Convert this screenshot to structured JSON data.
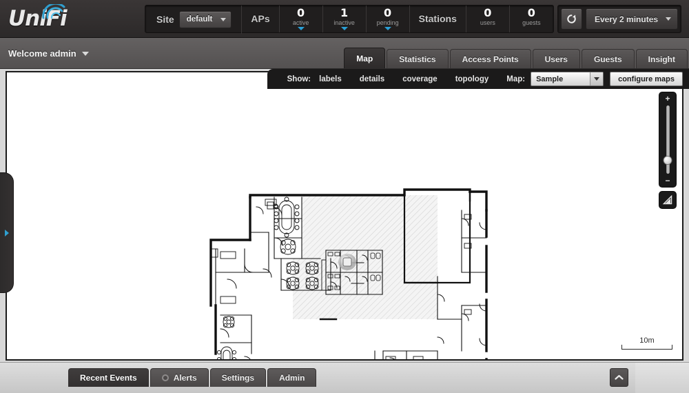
{
  "header": {
    "brand": "UniFi",
    "site_label": "Site",
    "site_value": "default",
    "aps_label": "APs",
    "stations_label": "Stations",
    "stats": [
      {
        "num": "0",
        "sub": "active",
        "caret": true
      },
      {
        "num": "1",
        "sub": "inactive",
        "caret": true
      },
      {
        "num": "0",
        "sub": "pending",
        "caret": true
      },
      {
        "num": "0",
        "sub": "users",
        "caret": false
      },
      {
        "num": "0",
        "sub": "guests",
        "caret": false
      }
    ],
    "refresh_icon": "refresh-icon",
    "refresh_value": "Every 2 minutes"
  },
  "nav": {
    "welcome": "Welcome admin",
    "tabs": [
      {
        "label": "Map",
        "active": true
      },
      {
        "label": "Statistics",
        "active": false
      },
      {
        "label": "Access Points",
        "active": false
      },
      {
        "label": "Users",
        "active": false
      },
      {
        "label": "Guests",
        "active": false
      },
      {
        "label": "Insight",
        "active": false
      }
    ]
  },
  "toolbar": {
    "show_label": "Show:",
    "options": [
      "labels",
      "details",
      "coverage",
      "topology"
    ],
    "map_label": "Map:",
    "map_value": "Sample",
    "configure_button": "configure maps"
  },
  "map": {
    "scale_text": "10m",
    "zoom_plus": "+",
    "zoom_minus": "−",
    "zoom_icon": "zoom-slider",
    "measure_icon": "measure-tool-icon",
    "flyout_icon": "flyout-arrow-icon",
    "accent_color": "#2f9fd0"
  },
  "footer": {
    "tabs": [
      {
        "label": "Recent Events",
        "active": true,
        "icon": null
      },
      {
        "label": "Alerts",
        "active": false,
        "icon": "alert-dot-icon"
      },
      {
        "label": "Settings",
        "active": false,
        "icon": null
      },
      {
        "label": "Admin",
        "active": false,
        "icon": null
      }
    ],
    "collapse_icon": "chevron-up-icon"
  }
}
